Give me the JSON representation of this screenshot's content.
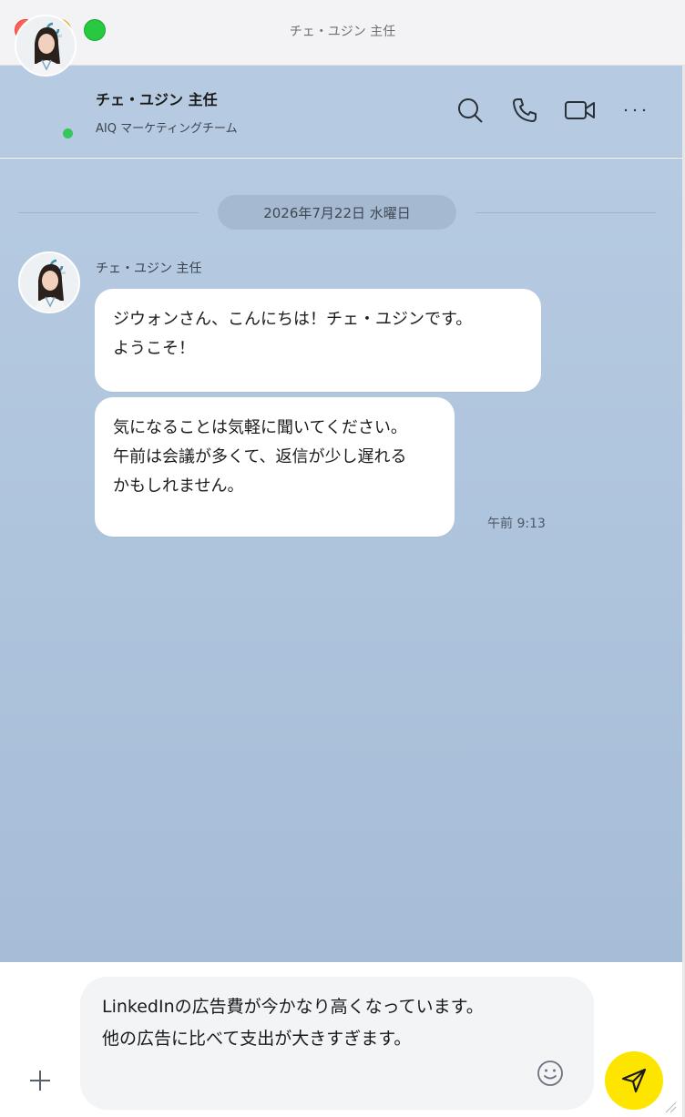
{
  "window": {
    "title": "チェ・ユジン 主任"
  },
  "header": {
    "contact_name": "チェ・ユジン 主任",
    "team": "AIQ マーケティングチーム",
    "online": true,
    "icons": [
      "search-icon",
      "phone-icon",
      "video-icon",
      "more-icon"
    ]
  },
  "chat": {
    "date_label": "2026年7月22日 水曜日",
    "sender_name": "チェ・ユジン 主任",
    "messages": [
      {
        "lines": [
          "ジウォンさん、こんにちは！チェ・ユジンです。",
          "ようこそ！"
        ]
      },
      {
        "lines": [
          "気になることは気軽に聞いてください。",
          "午前は会議が多くて、返信が少し遅れる",
          "かもしれません。"
        ]
      }
    ],
    "time": "午前 9:13"
  },
  "composer": {
    "lines": [
      "LinkedInの広告費が今かなり高くなっています。",
      "他の広告に比べて支出が大きすぎます。"
    ]
  },
  "colors": {
    "chat_bg": "#b6cbe1",
    "bubble": "#ffffff",
    "send_button": "#fee500",
    "online": "#34c759"
  }
}
